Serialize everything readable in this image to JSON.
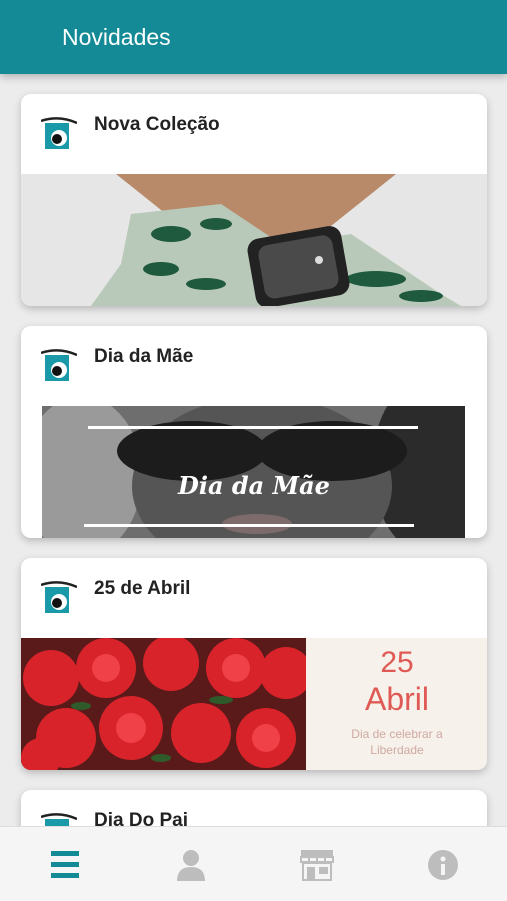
{
  "appbar": {
    "title": "Novidades"
  },
  "cards": [
    {
      "title": "Nova Coleção"
    },
    {
      "title": "Dia da Mãe",
      "banner_text": "Dia da Mãe"
    },
    {
      "title": "25 de Abril",
      "promo_number": "25",
      "promo_month": "Abril",
      "promo_line1": "Dia de celebrar a",
      "promo_line2": "Liberdade"
    },
    {
      "title": "Dia Do Pai"
    }
  ],
  "colors": {
    "primary": "#138a96",
    "accent_red": "#e05a55",
    "inactive_icon": "#bdbdbd"
  },
  "bottom_nav": [
    {
      "icon": "menu-icon",
      "active": true
    },
    {
      "icon": "user-icon",
      "active": false
    },
    {
      "icon": "store-icon",
      "active": false
    },
    {
      "icon": "info-icon",
      "active": false
    }
  ]
}
